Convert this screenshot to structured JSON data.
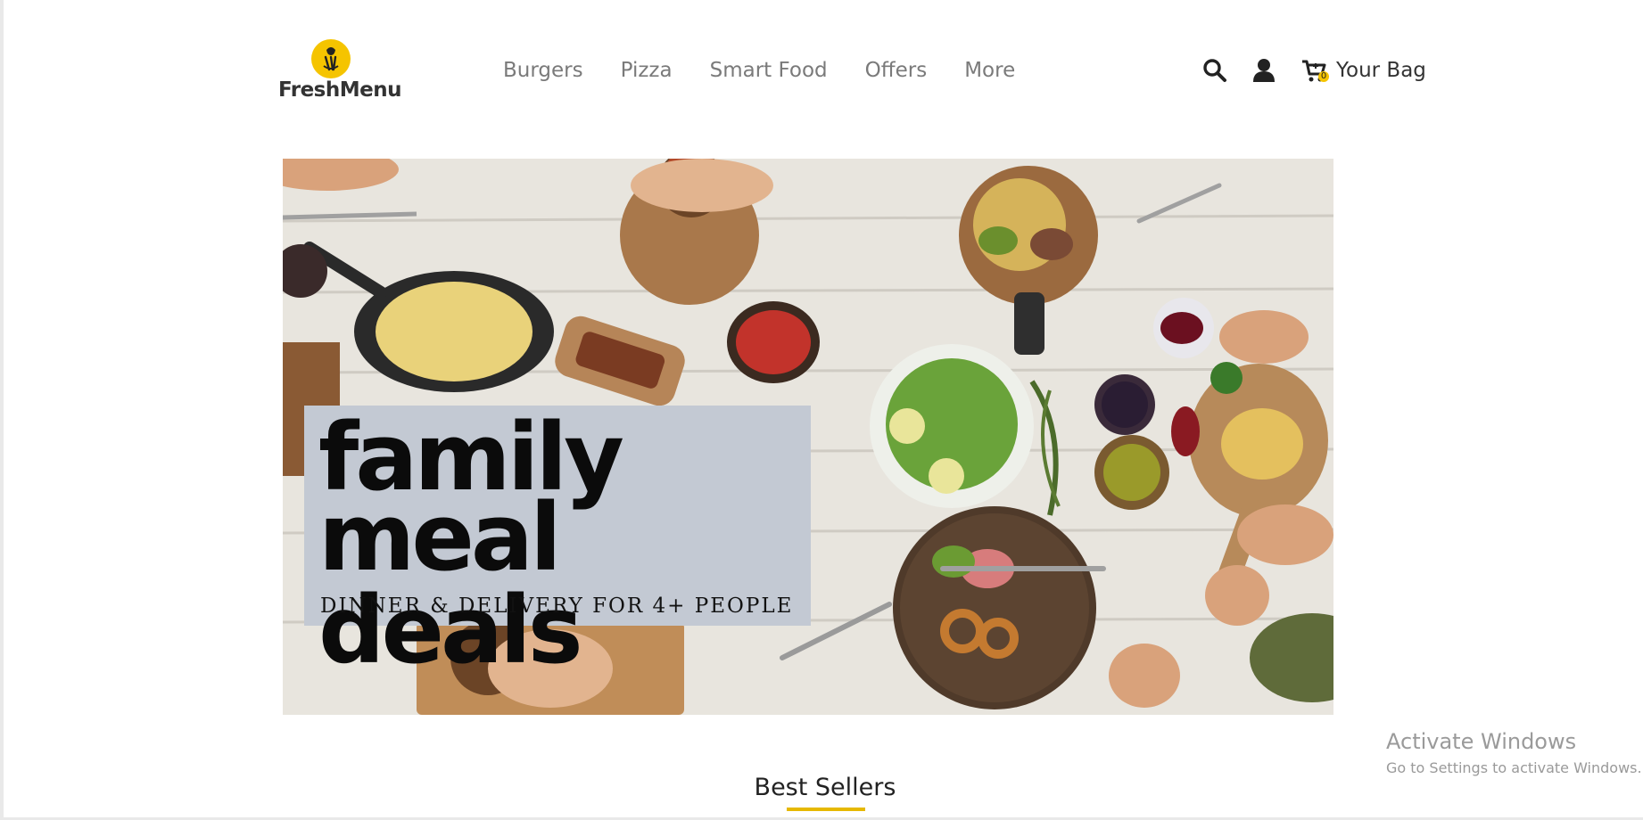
{
  "header": {
    "logo_text": "FreshMenu",
    "nav": [
      {
        "label": "Burgers"
      },
      {
        "label": "Pizza"
      },
      {
        "label": "Smart Food"
      },
      {
        "label": "Offers"
      },
      {
        "label": "More"
      }
    ],
    "search_icon": "search-icon",
    "account_icon": "user-icon",
    "cart_icon": "cart-icon",
    "cart_count": "0",
    "bag_label": "Your Bag"
  },
  "hero": {
    "line1": "family",
    "line2": "meal deals",
    "subtitle": "DINNER & DELIVERY FOR 4+ PEOPLE"
  },
  "section": {
    "title": "Best Sellers"
  },
  "watermark": {
    "line1": "Activate Windows",
    "line2": "Go to Settings to activate Windows."
  },
  "colors": {
    "accent": "#f5c400",
    "nav_text": "#7a7a7a",
    "promo_box": "#c3c9d3",
    "underline": "#e6b800"
  }
}
